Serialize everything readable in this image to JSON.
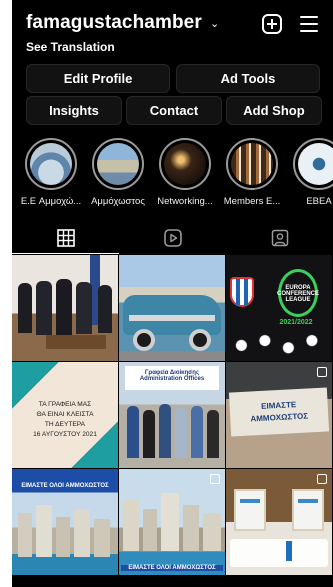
{
  "header": {
    "username": "famagustachamber",
    "caret": "⌄",
    "add_icon": "plus-square-icon",
    "menu_icon": "hamburger-menu-icon"
  },
  "profile": {
    "see_translation": "See Translation"
  },
  "buttons": {
    "edit_profile": "Edit Profile",
    "ad_tools": "Ad Tools",
    "insights": "Insights",
    "contact": "Contact",
    "add_shop": "Add Shop"
  },
  "highlights": [
    {
      "label": "E.E Αμμοχώ..."
    },
    {
      "label": "Αμμόχωστος"
    },
    {
      "label": "Networking..."
    },
    {
      "label": "Members E..."
    },
    {
      "label": "EBEA"
    }
  ],
  "tabs": [
    {
      "name": "grid-icon",
      "active": true
    },
    {
      "name": "reels-icon",
      "active": false
    },
    {
      "name": "tagged-icon",
      "active": false
    }
  ],
  "posts": {
    "p3_line1": "EUROPA",
    "p3_line2": "CONFERENCE",
    "p3_line3": "LEAGUE",
    "p3_season": "2021/2022",
    "p4_text_1": "ΤΑ ΓΡΑΦΕΙΑ ΜΑΣ",
    "p4_text_2": "ΘΑ ΕΙΝΑΙ ΚΛΕΙΣΤΑ",
    "p4_text_3": "ΤΗ ΔΕΥΤΕΡΑ",
    "p4_text_4": "16 ΑΥΓΟΥΣΤΟΥ 2021",
    "p5_sign_1": "Γραφεία Διοίκησης",
    "p5_sign_2": "Administration Offices",
    "p6_banner_1": "ΕΙΜΑΣΤΕ",
    "p6_banner_2": "ΑΜΜΟΧΩΣΤΟΣ",
    "p7_banner": "ΕΙΜΑΣΤΕ ΟΛΟΙ ΑΜΜΟΧΩΣΤΟΣ",
    "p8_banner": "ΕΙΜΑΣΤΕ ΟΛΟΙ ΑΜΜΟΧΩΣΤΟΣ"
  }
}
